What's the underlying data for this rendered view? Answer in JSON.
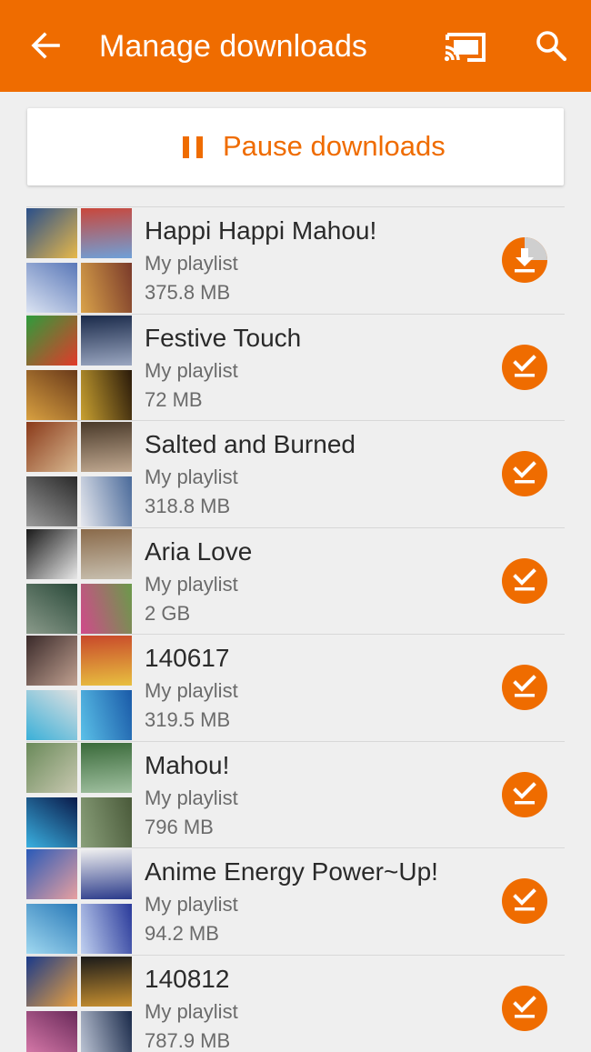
{
  "header": {
    "title": "Manage downloads",
    "icons": [
      "back-arrow-icon",
      "cast-icon",
      "search-icon"
    ]
  },
  "pause": {
    "label": "Pause downloads",
    "icon": "pause-icon"
  },
  "colors": {
    "accent": "#ef6c00",
    "background": "#efefef"
  },
  "playlists": [
    {
      "name": "Happi Happi Mahou!",
      "subtitle": "My playlist",
      "size": "375.8 MB",
      "status": "downloading",
      "progress": 0.25,
      "art": [
        [
          "#2a4f8a",
          "#e7b84a"
        ],
        [
          "#c9473b",
          "#6fa0d8"
        ],
        [
          "#5a78b8",
          "#dbe3f2"
        ],
        [
          "#7a3a2a",
          "#d9a24a"
        ]
      ]
    },
    {
      "name": "Festive Touch",
      "subtitle": "My playlist",
      "size": "72 MB",
      "status": "downloaded",
      "art": [
        [
          "#2e9c3c",
          "#e23a2a"
        ],
        [
          "#1a2a4a",
          "#9aa6c0"
        ],
        [
          "#6a3a1a",
          "#d8a040"
        ],
        [
          "#2a1a0a",
          "#c8a030"
        ]
      ]
    },
    {
      "name": "Salted and Burned",
      "subtitle": "My playlist",
      "size": "318.8 MB",
      "status": "downloaded",
      "art": [
        [
          "#8a3a1a",
          "#d8b890"
        ],
        [
          "#4a3a2a",
          "#c0a890"
        ],
        [
          "#2a2a2a",
          "#9a9a9a"
        ],
        [
          "#4a6a9a",
          "#e6e8ee"
        ]
      ]
    },
    {
      "name": "Aria Love",
      "subtitle": "My playlist",
      "size": "2 GB",
      "status": "downloaded",
      "art": [
        [
          "#1a1a1a",
          "#e8e8e8"
        ],
        [
          "#8a6a4a",
          "#c8c0b0"
        ],
        [
          "#2a4a3a",
          "#8a9a8a"
        ],
        [
          "#6a9a4a",
          "#d04a8a"
        ]
      ]
    },
    {
      "name": "140617",
      "subtitle": "My playlist",
      "size": "319.5 MB",
      "status": "downloaded",
      "art": [
        [
          "#3a2a2a",
          "#c0a090"
        ],
        [
          "#c8482a",
          "#e8c040"
        ],
        [
          "#e0e0e0",
          "#3ab0d8"
        ],
        [
          "#1a5aa8",
          "#5ac0e8"
        ]
      ]
    },
    {
      "name": "Mahou!",
      "subtitle": "My playlist",
      "size": "796 MB",
      "status": "downloaded",
      "art": [
        [
          "#6a8a5a",
          "#c8c8b0"
        ],
        [
          "#3a6a3a",
          "#a0c0a0"
        ],
        [
          "#0a1a4a",
          "#3ab0e0"
        ],
        [
          "#4a5a3a",
          "#8aa07a"
        ]
      ]
    },
    {
      "name": "Anime Energy Power~Up!",
      "subtitle": "My playlist",
      "size": "94.2 MB",
      "status": "downloaded",
      "art": [
        [
          "#2a5ab8",
          "#e8a0a0"
        ],
        [
          "#f0f0f0",
          "#2a3a8a"
        ],
        [
          "#2a7ab8",
          "#a0d8f0"
        ],
        [
          "#2a3a9a",
          "#c0d0f0"
        ]
      ]
    },
    {
      "name": "140812",
      "subtitle": "My playlist",
      "size": "787.9 MB",
      "status": "downloaded",
      "art": [
        [
          "#1a3a8a",
          "#e8a040"
        ],
        [
          "#1a1a1a",
          "#c89030"
        ],
        [
          "#6a2a5a",
          "#e080b0"
        ],
        [
          "#1a2a4a",
          "#c0c8d8"
        ]
      ]
    }
  ]
}
